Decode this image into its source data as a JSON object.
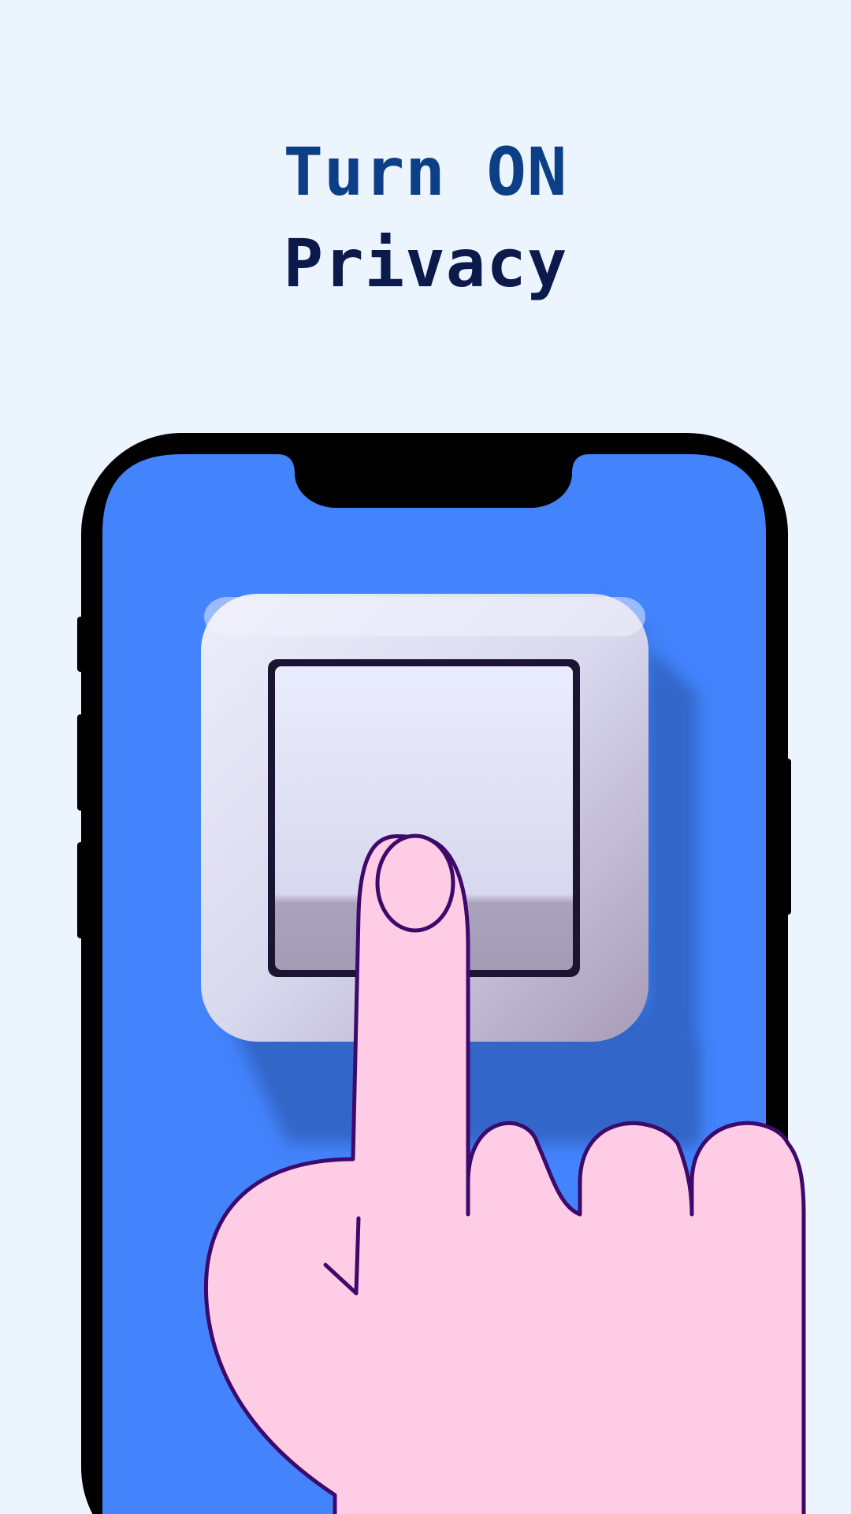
{
  "headline": {
    "line1": "Turn ON",
    "line2": "Privacy"
  },
  "colors": {
    "background": "#ecf5fe",
    "headline_primary": "#0d3f86",
    "headline_secondary": "#0b1a4a",
    "phone_frame": "#000000",
    "phone_screen": "#4383fc",
    "switch_plate": "#dcdcef",
    "hand_fill": "#ffcce6",
    "hand_outline": "#3d0a6b"
  },
  "icons": {
    "illustration": "finger-pressing-switch-illustration"
  }
}
